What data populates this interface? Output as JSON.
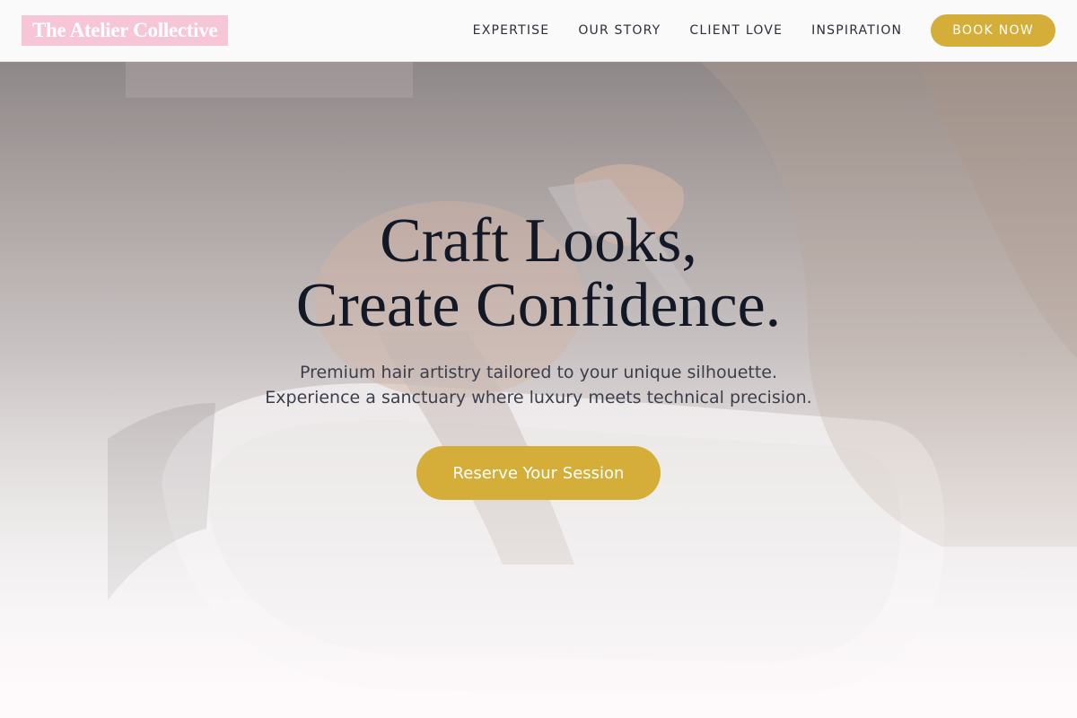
{
  "brand": {
    "name": "The Atelier Collective",
    "logo_bg": "#f7c6d6"
  },
  "nav": {
    "items": [
      {
        "label": "EXPERTISE"
      },
      {
        "label": "OUR STORY"
      },
      {
        "label": "CLIENT LOVE"
      },
      {
        "label": "INSPIRATION"
      }
    ],
    "cta_label": "BOOK NOW"
  },
  "hero": {
    "title_line1": "Craft Looks,",
    "title_line2": "Create Confidence.",
    "subtitle_line1": "Premium hair artistry tailored to your unique silhouette.",
    "subtitle_line2": "Experience a sanctuary where luxury meets technical precision.",
    "cta_label": "Reserve Your Session",
    "background": "salon-hair-wash-photo"
  },
  "colors": {
    "accent": "#d4ae38",
    "heading": "#121826",
    "body_text": "#3b3f4c"
  }
}
